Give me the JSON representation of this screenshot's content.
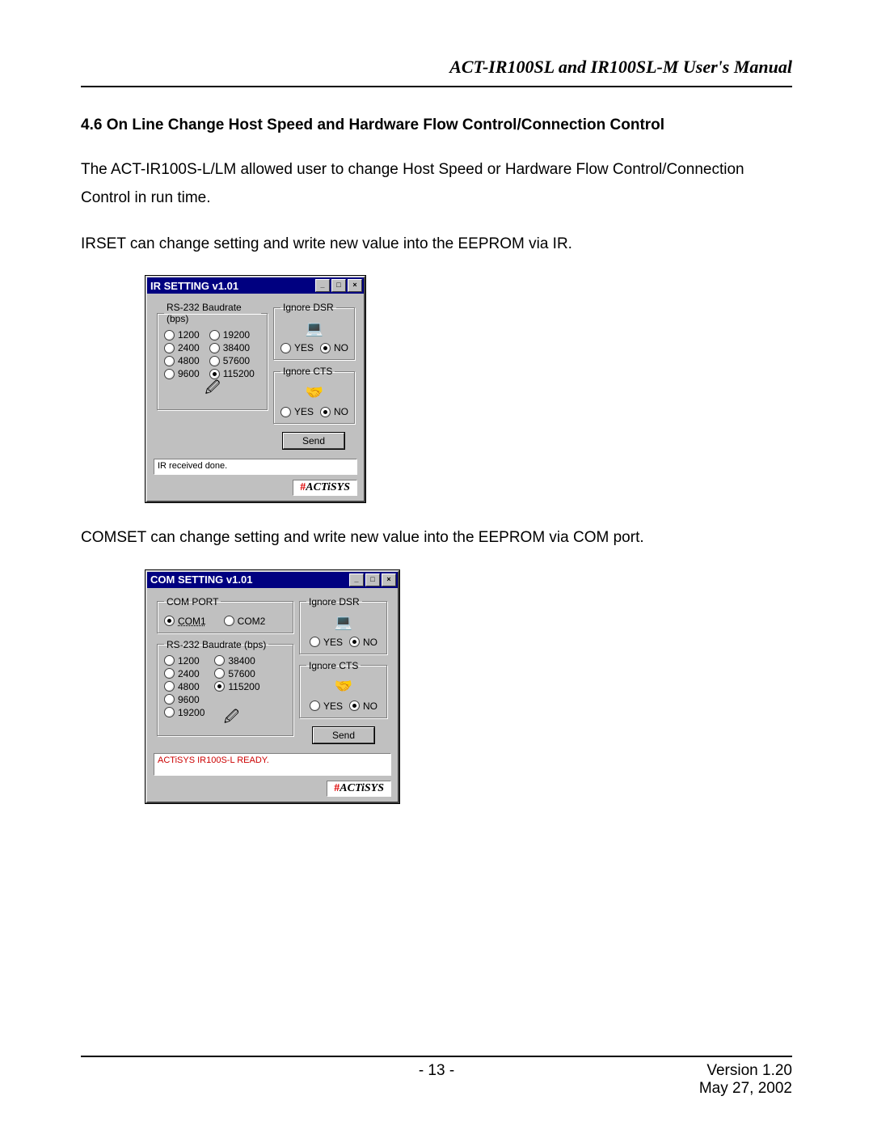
{
  "header": {
    "manual_title": "ACT-IR100SL and IR100SL-M User's Manual"
  },
  "section": {
    "heading": "4.6 On Line Change Host Speed and Hardware Flow Control/Connection Control",
    "para1": "The ACT-IR100S-L/LM allowed user to change Host Speed or Hardware Flow Control/Connection Control in run time.",
    "para2": "IRSET can change setting and write new value into the EEPROM via IR.",
    "para3": "COMSET can change setting and write new value into the EEPROM via COM port."
  },
  "common": {
    "min_btn": "_",
    "max_btn": "□",
    "close_btn": "×",
    "yes": "YES",
    "no": "NO",
    "send": "Send",
    "brand": "ACTiSYS",
    "brand_bang": "#"
  },
  "irset": {
    "title": "IR SETTING v1.01",
    "baud_legend": "RS-232 Baudrate (bps)",
    "baud_left": [
      "1200",
      "2400",
      "4800",
      "9600"
    ],
    "baud_right": [
      "19200",
      "38400",
      "57600",
      "115200"
    ],
    "baud_selected": "115200",
    "dsr_legend": "Ignore DSR",
    "dsr_selected": "NO",
    "cts_legend": "Ignore CTS",
    "cts_selected": "NO",
    "status": "IR received done."
  },
  "comset": {
    "title": "COM SETTING v1.01",
    "port_legend": "COM PORT",
    "ports": [
      "COM1",
      "COM2"
    ],
    "port_selected": "COM1",
    "baud_legend": "RS-232 Baudrate (bps)",
    "baud_left": [
      "1200",
      "2400",
      "4800",
      "9600",
      "19200"
    ],
    "baud_right": [
      "38400",
      "57600",
      "115200"
    ],
    "baud_selected": "115200",
    "dsr_legend": "Ignore DSR",
    "dsr_selected": "NO",
    "cts_legend": "Ignore CTS",
    "cts_selected": "NO",
    "status": "ACTiSYS IR100S-L READY."
  },
  "footer": {
    "page": "- 13 -",
    "version": "Version 1.20",
    "date": "May 27, 2002"
  }
}
